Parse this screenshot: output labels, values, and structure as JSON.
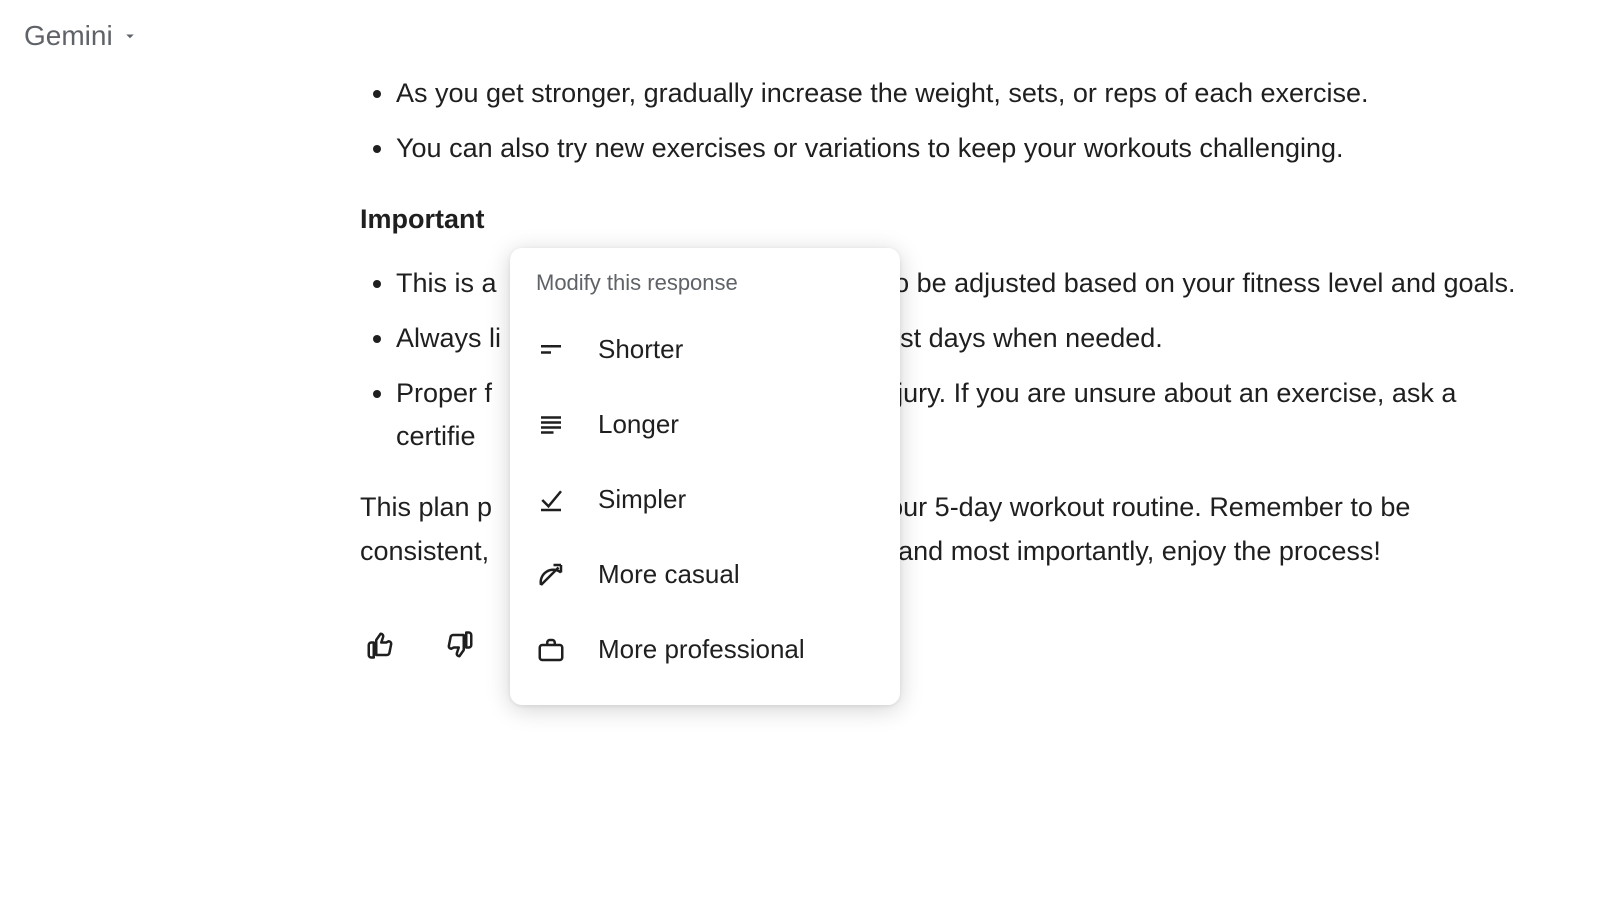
{
  "header": {
    "model_name": "Gemini"
  },
  "response": {
    "bullets_top": [
      "As you get stronger, gradually increase the weight, sets, or reps of each exercise.",
      "You can also try new exercises or variations to keep your workouts challenging."
    ],
    "notes_heading": "Important",
    "notes_bullets": [
      "This is a                                                    to be adjusted based on your fitness level and goals.",
      "Always li                                                  rest days when needed.",
      "Proper f                                                    njury. If you are unsure about an exercise, ask a certifie                                                  nce."
    ],
    "closing": "This plan p                                                   your 5-day workout routine. Remember to be consistent,                                                   y, and most importantly, enjoy the process!"
  },
  "popup": {
    "title": "Modify this response",
    "options": {
      "shorter": "Shorter",
      "longer": "Longer",
      "simpler": "Simpler",
      "casual": "More casual",
      "professional": "More professional"
    }
  }
}
